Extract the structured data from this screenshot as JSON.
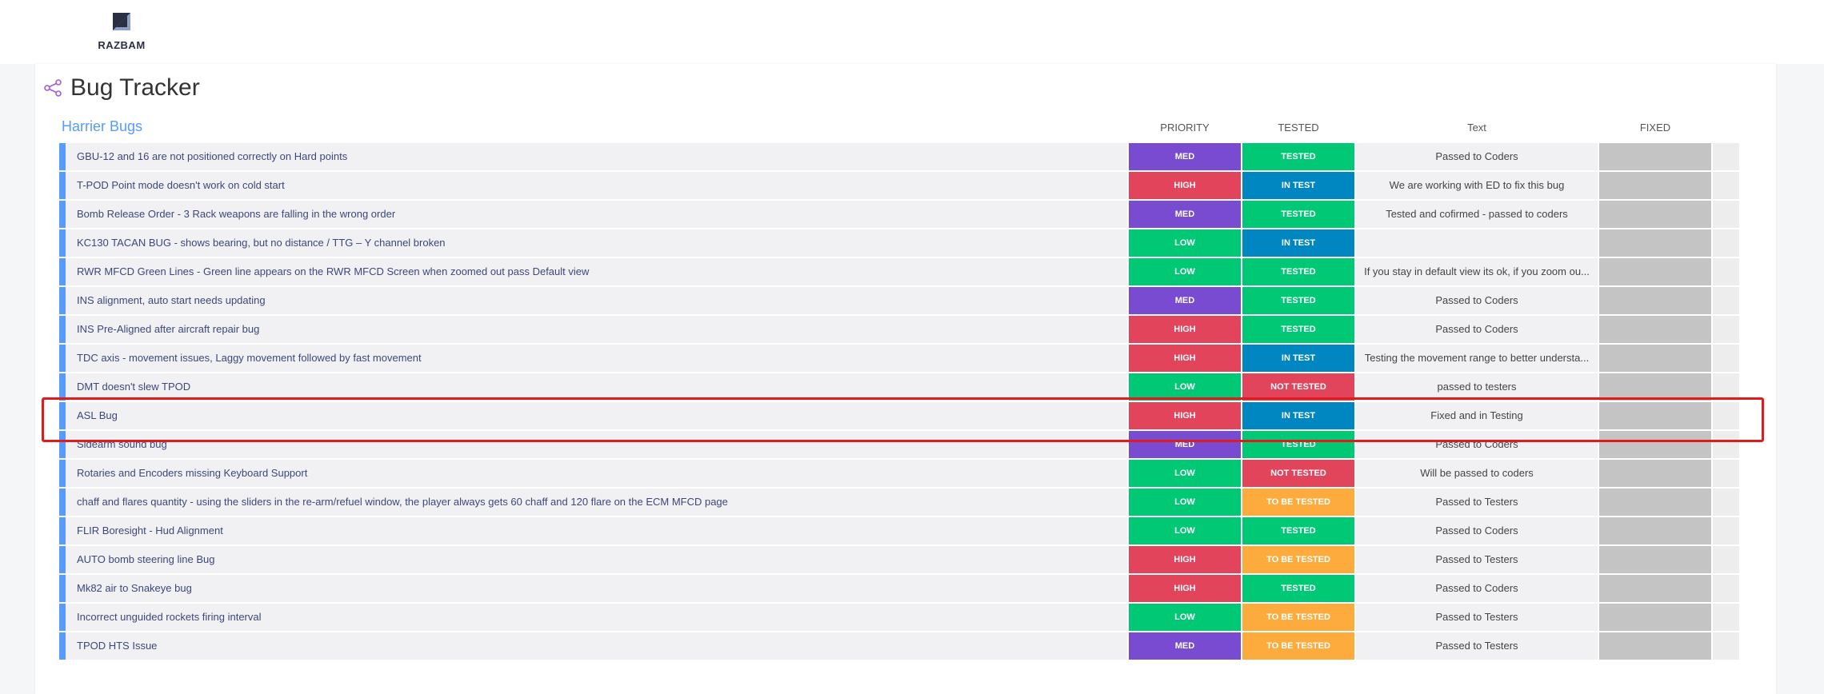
{
  "brand": {
    "logo_text": "RAZBAM"
  },
  "board": {
    "title": "Bug Tracker",
    "group": "Harrier Bugs",
    "columns": {
      "priority": "PRIORITY",
      "tested": "TESTED",
      "text": "Text",
      "fixed": "FIXED"
    }
  },
  "colors": {
    "MED": "#784bd1",
    "HIGH": "#e2445c",
    "LOW": "#00c875",
    "TESTED": "#00c875",
    "IN TEST": "#0086c0",
    "NOT TESTED": "#e2445c",
    "TO BE TESTED": "#fdab3d",
    "group_accent": "#579bfc",
    "highlight_border": "#e01b1b"
  },
  "rows": [
    {
      "name": "GBU-12 and 16 are not positioned correctly on Hard points",
      "priority": "MED",
      "tested": "TESTED",
      "text": "Passed to Coders"
    },
    {
      "name": "T-POD Point mode doesn't work on cold start",
      "priority": "HIGH",
      "tested": "IN TEST",
      "text": "We are working with ED to fix this bug"
    },
    {
      "name": "Bomb Release Order - 3 Rack weapons are falling in the wrong order",
      "priority": "MED",
      "tested": "TESTED",
      "text": "Tested and cofirmed - passed to coders"
    },
    {
      "name": "KC130 TACAN BUG - shows bearing, but no distance / TTG – Y channel broken",
      "priority": "LOW",
      "tested": "IN TEST",
      "text": ""
    },
    {
      "name": "RWR MFCD Green Lines - Green line appears on the RWR MFCD Screen when zoomed out pass Default view",
      "priority": "LOW",
      "tested": "TESTED",
      "text": "If you stay in default view its ok, if you zoom ou..."
    },
    {
      "name": "INS alignment, auto start needs updating",
      "priority": "MED",
      "tested": "TESTED",
      "text": "Passed to Coders"
    },
    {
      "name": "INS Pre-Aligned after aircraft repair bug",
      "priority": "HIGH",
      "tested": "TESTED",
      "text": "Passed to Coders"
    },
    {
      "name": "TDC axis - movement issues, Laggy movement followed by fast movement",
      "priority": "HIGH",
      "tested": "IN TEST",
      "text": "Testing the movement range to better understa..."
    },
    {
      "name": "DMT doesn't slew TPOD",
      "priority": "LOW",
      "tested": "NOT TESTED",
      "text": "passed to testers"
    },
    {
      "name": "ASL Bug",
      "priority": "HIGH",
      "tested": "IN TEST",
      "text": "Fixed and in Testing"
    },
    {
      "name": "Sidearm sound bug",
      "priority": "MED",
      "tested": "TESTED",
      "text": "Passed to Coders"
    },
    {
      "name": "Rotaries and Encoders missing Keyboard Support",
      "priority": "LOW",
      "tested": "NOT TESTED",
      "text": "Will be passed to coders"
    },
    {
      "name": "chaff and flares quantity - using the sliders in the re-arm/refuel window, the player always gets 60 chaff and 120 flare on the ECM MFCD page",
      "priority": "LOW",
      "tested": "TO BE TESTED",
      "text": "Passed to Testers"
    },
    {
      "name": "FLIR Boresight - Hud Alignment",
      "priority": "LOW",
      "tested": "TESTED",
      "text": "Passed to Coders"
    },
    {
      "name": "AUTO bomb steering line Bug",
      "priority": "HIGH",
      "tested": "TO BE TESTED",
      "text": "Passed to Testers"
    },
    {
      "name": "Mk82 air to Snakeye bug",
      "priority": "HIGH",
      "tested": "TESTED",
      "text": "Passed to Coders"
    },
    {
      "name": "Incorrect unguided rockets firing interval",
      "priority": "LOW",
      "tested": "TO BE TESTED",
      "text": "Passed to Testers"
    },
    {
      "name": "TPOD HTS Issue",
      "priority": "MED",
      "tested": "TO BE TESTED",
      "text": "Passed to Testers"
    }
  ]
}
